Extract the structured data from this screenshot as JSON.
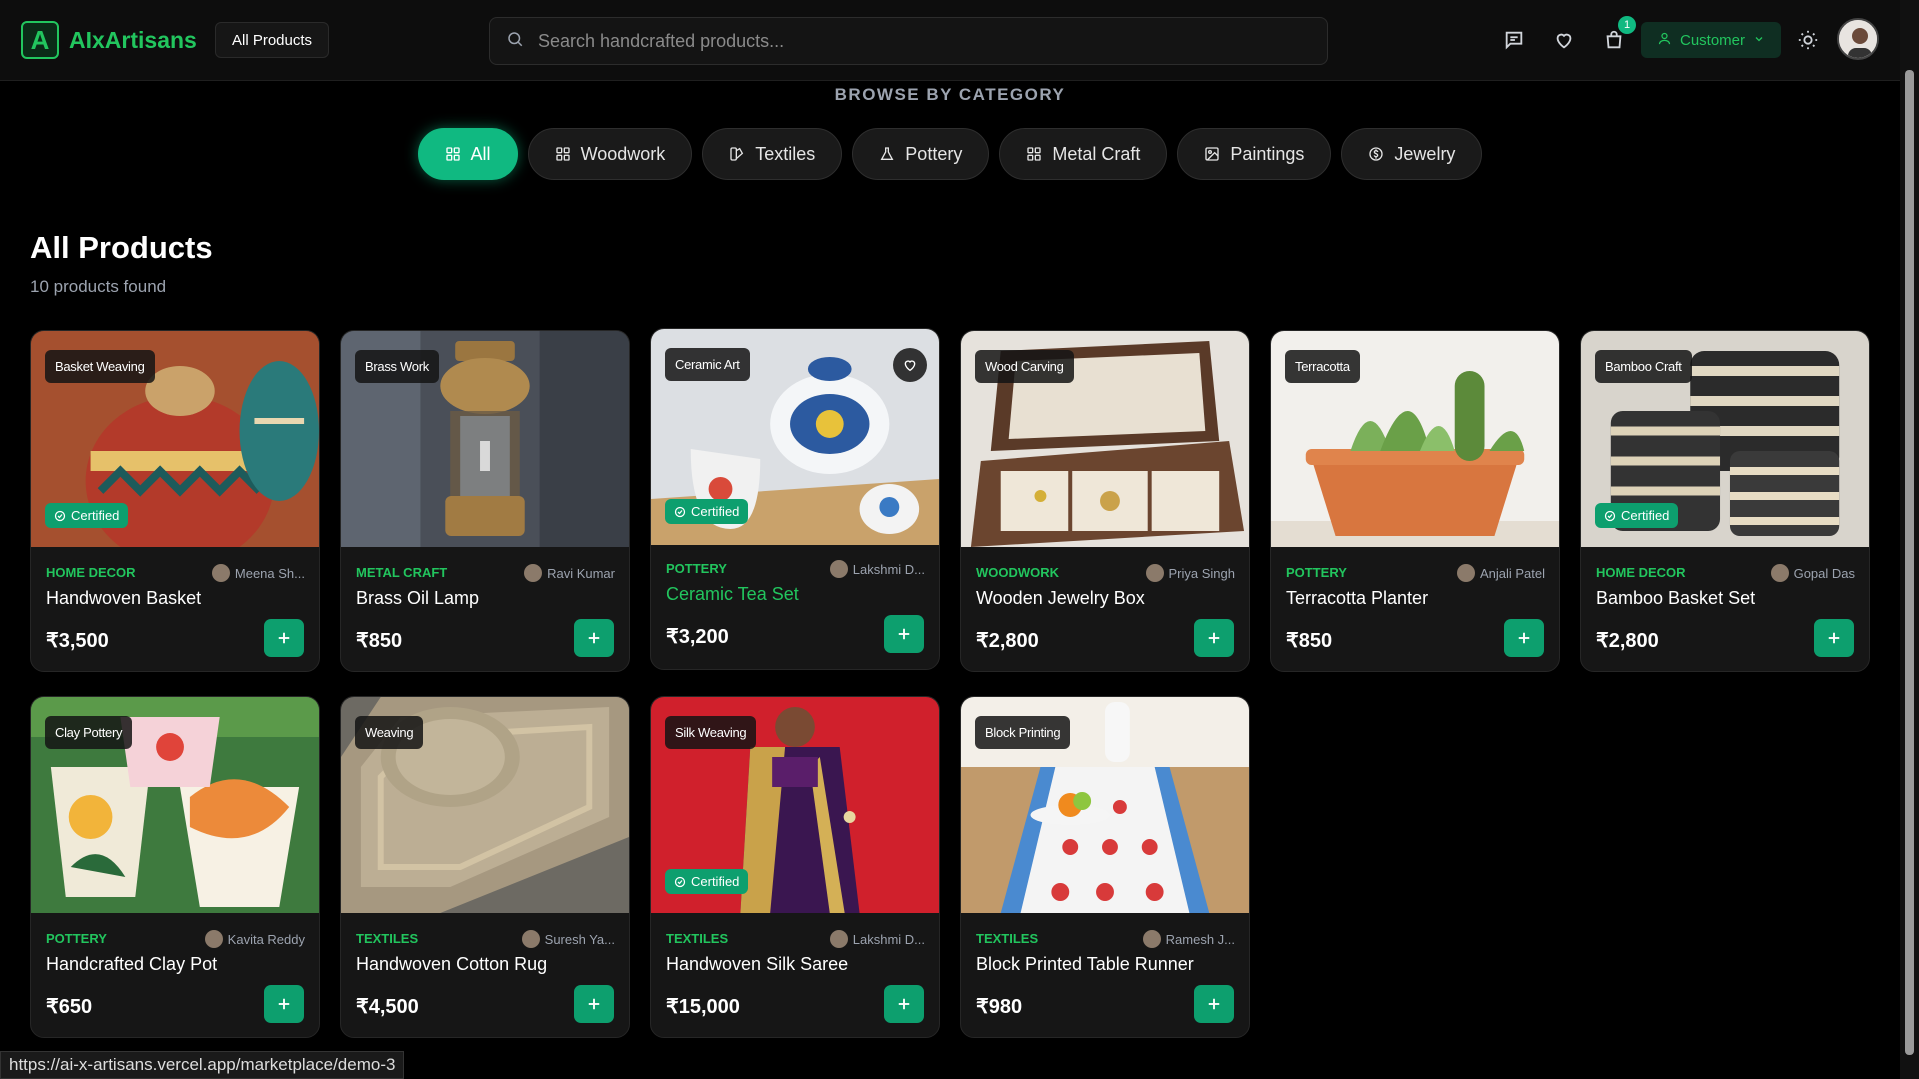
{
  "header": {
    "logo_letter": "A",
    "brand": "AIxArtisans",
    "all_products_label": "All Products",
    "search_placeholder": "Search handcrafted products...",
    "cart_count": "1",
    "role_label": "Customer"
  },
  "category_section": {
    "title": "BROWSE BY CATEGORY",
    "items": [
      {
        "label": "All",
        "icon": "grid-icon",
        "active": true
      },
      {
        "label": "Woodwork",
        "icon": "grid-icon"
      },
      {
        "label": "Textiles",
        "icon": "swatch-icon"
      },
      {
        "label": "Pottery",
        "icon": "flask-icon"
      },
      {
        "label": "Metal Craft",
        "icon": "grid-icon"
      },
      {
        "label": "Paintings",
        "icon": "image-icon"
      },
      {
        "label": "Jewelry",
        "icon": "gem-icon"
      }
    ]
  },
  "products_section": {
    "title": "All Products",
    "count_text": "10 products found"
  },
  "products": [
    {
      "tag": "Basket Weaving",
      "certified": true,
      "category": "HOME DECOR",
      "artisan": "Meena Sh...",
      "name": "Handwoven Basket",
      "price": "₹3,500"
    },
    {
      "tag": "Brass Work",
      "certified": false,
      "category": "METAL CRAFT",
      "artisan": "Ravi Kumar",
      "name": "Brass Oil Lamp",
      "price": "₹850"
    },
    {
      "tag": "Ceramic Art",
      "certified": true,
      "category": "POTTERY",
      "artisan": "Lakshmi D...",
      "name": "Ceramic Tea Set",
      "price": "₹3,200"
    },
    {
      "tag": "Wood Carving",
      "certified": false,
      "category": "WOODWORK",
      "artisan": "Priya Singh",
      "name": "Wooden Jewelry Box",
      "price": "₹2,800"
    },
    {
      "tag": "Terracotta",
      "certified": false,
      "category": "POTTERY",
      "artisan": "Anjali Patel",
      "name": "Terracotta Planter",
      "price": "₹850"
    },
    {
      "tag": "Bamboo Craft",
      "certified": true,
      "category": "HOME DECOR",
      "artisan": "Gopal Das",
      "name": "Bamboo Basket Set",
      "price": "₹2,800"
    },
    {
      "tag": "Clay Pottery",
      "certified": false,
      "category": "POTTERY",
      "artisan": "Kavita Reddy",
      "name": "Handcrafted Clay Pot",
      "price": "₹650"
    },
    {
      "tag": "Weaving",
      "certified": false,
      "category": "TEXTILES",
      "artisan": "Suresh Ya...",
      "name": "Handwoven Cotton Rug",
      "price": "₹4,500"
    },
    {
      "tag": "Silk Weaving",
      "certified": true,
      "category": "TEXTILES",
      "artisan": "Lakshmi D...",
      "name": "Handwoven Silk Saree",
      "price": "₹15,000"
    },
    {
      "tag": "Block Printing",
      "certified": false,
      "category": "TEXTILES",
      "artisan": "Ramesh J...",
      "name": "Block Printed Table Runner",
      "price": "₹980"
    }
  ],
  "certified_label": "Certified",
  "status_url": "https://ai-x-artisans.vercel.app/marketplace/demo-3",
  "colors": {
    "accent": "#10b981",
    "brand": "#22c55e",
    "bg": "#000000",
    "card": "#161616"
  }
}
